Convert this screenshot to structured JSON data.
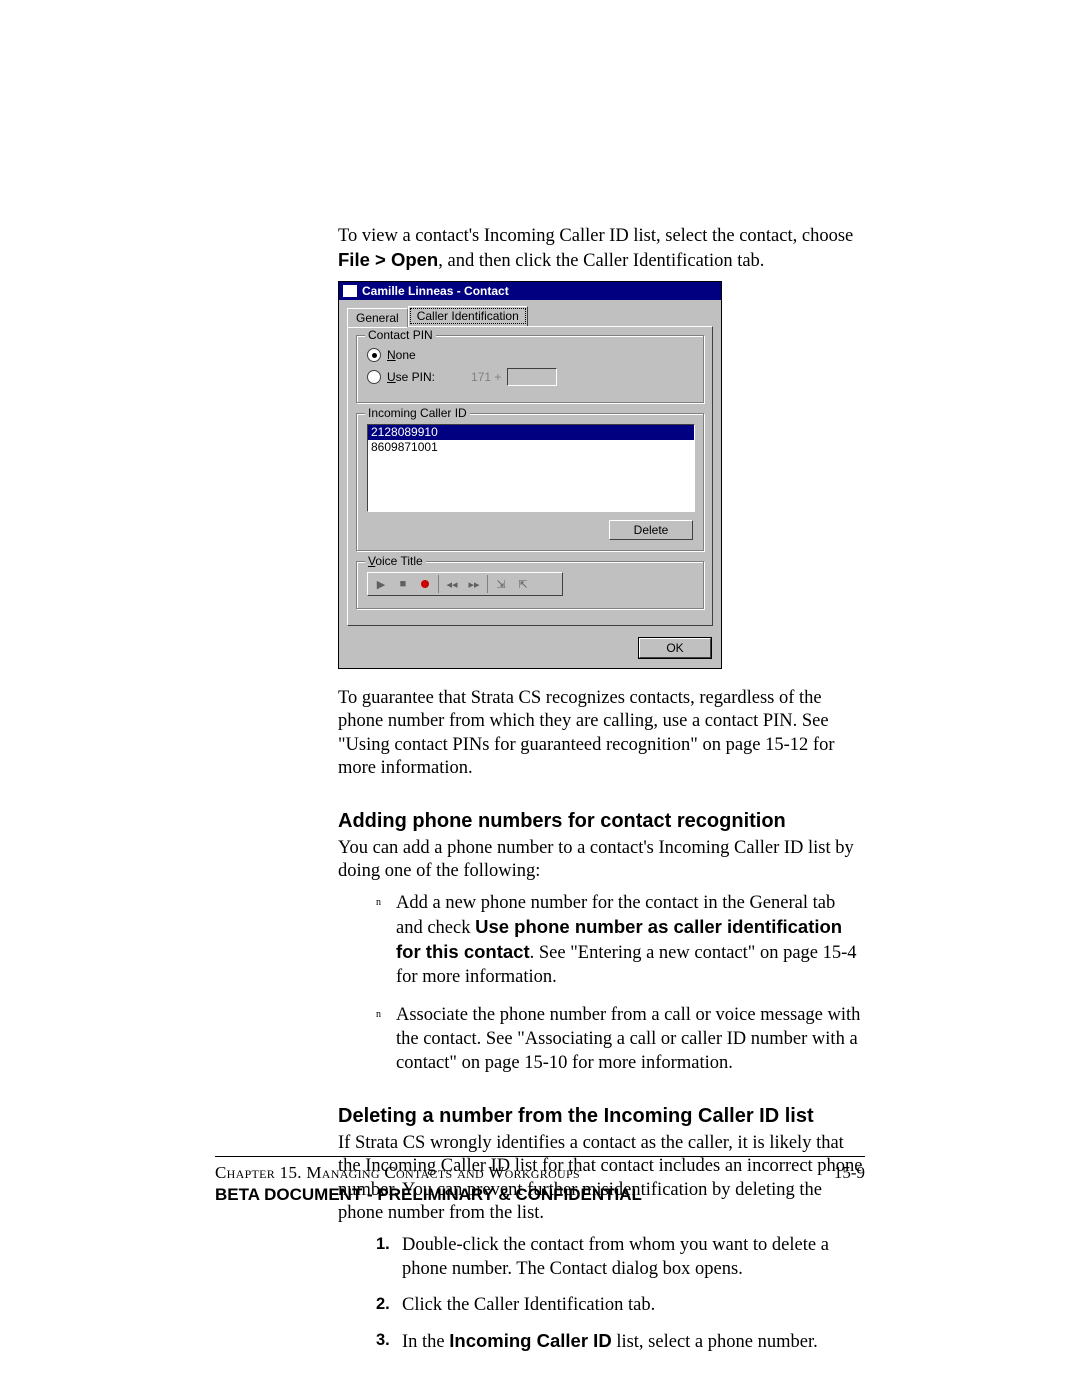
{
  "intro": {
    "p1a": "To view a contact's Incoming Caller ID list, select the contact, choose ",
    "p1b": "File > Open",
    "p1c": ", and then click the Caller Identification tab."
  },
  "dialog": {
    "title": "Camille Linneas - Contact",
    "tabs": {
      "general": "General",
      "caller_id": "Caller Identification"
    },
    "contact_pin": {
      "legend": "Contact PIN",
      "none": "None",
      "use_pin": "Use PIN:",
      "prefix": "171 +"
    },
    "incoming": {
      "legend": "Incoming Caller ID",
      "rows": [
        "2128089910",
        "8609871001"
      ],
      "delete": "Delete"
    },
    "voice": {
      "legend": "Voice Title"
    },
    "ok": "OK"
  },
  "after_dialog": "To guarantee that Strata CS recognizes contacts, regardless of the phone number from which they are calling, use a contact PIN. See \"Using contact PINs for guaranteed recognition\" on page 15-12 for more information.",
  "section_add": {
    "heading": "Adding phone numbers for contact recognition",
    "intro": "You can add a phone number to a contact's Incoming Caller ID list by doing one of the following:",
    "b1a": "Add a new phone number for the contact in the General tab and check ",
    "b1b": "Use phone number as caller identification for this contact",
    "b1c": ". See \"Entering a new contact\" on page 15-4 for more information.",
    "b2": "Associate the phone number from a call or voice message with the contact. See \"Associating a call or caller ID number with a contact\" on page 15-10 for more information."
  },
  "section_del": {
    "heading": "Deleting a number from the Incoming Caller ID list",
    "intro": "If Strata CS wrongly identifies a contact as the caller, it is likely that the Incoming Caller ID list for that contact includes an incorrect phone number. You can prevent further misidentification by deleting the phone number from the list.",
    "s1": "Double-click the contact from whom you want to delete a phone number. The Contact dialog box opens.",
    "s2": "Click the Caller Identification tab.",
    "s3a": "In the ",
    "s3b": "Incoming Caller ID",
    "s3c": " list, select a phone number."
  },
  "footer": {
    "chapter": "Chapter 15. Managing Contacts and Workgroups",
    "page": "15-9",
    "confidential": "BETA DOCUMENT - PRELIMINARY & CONFIDENTIAL"
  },
  "marks": {
    "n1": "1.",
    "n2": "2.",
    "n3": "3.",
    "bullet": "n"
  }
}
